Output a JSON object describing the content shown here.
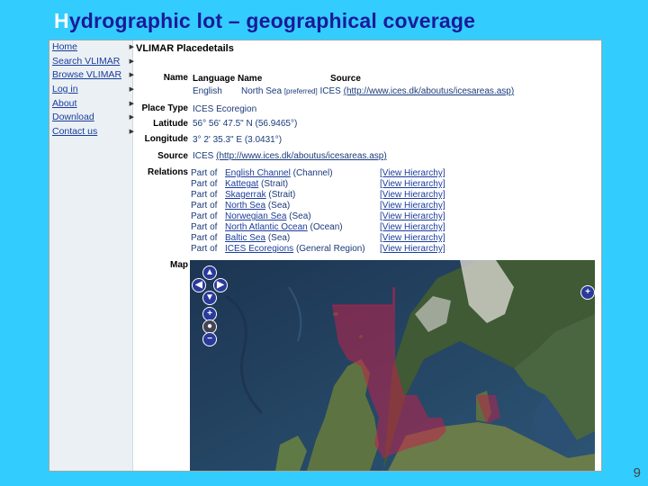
{
  "slide": {
    "title_first": "H",
    "title_rest": "ydrographic lot – geographical coverage",
    "page_number": "9"
  },
  "nav": {
    "items": [
      {
        "label": "Home"
      },
      {
        "label": "Search VLIMAR"
      },
      {
        "label": "Browse VLIMAR"
      },
      {
        "label": "Log in"
      },
      {
        "label": "About"
      },
      {
        "label": "Download"
      },
      {
        "label": "Contact us"
      }
    ]
  },
  "place": {
    "title": "VLIMAR Placedetails",
    "name_label": "Name",
    "language_header": "Language",
    "name_header": "Name",
    "source_header": "Source",
    "language": "English",
    "name_value": "North Sea",
    "preferred": "[preferred]",
    "name_source": "ICES",
    "name_source_link": "(http://www.ices.dk/aboutus/icesareas.asp)",
    "placetype_label": "Place Type",
    "placetype_value": "ICES Ecoregion",
    "latitude_label": "Latitude",
    "latitude_value": "56° 56' 47.5\" N (56.9465°)",
    "longitude_label": "Longitude",
    "longitude_value": "3° 2' 35.3\" E (3.0431°)",
    "source_label": "Source",
    "source_value": "ICES",
    "source_link": "(http://www.ices.dk/aboutus/icesareas.asp)",
    "relations_label": "Relations",
    "relations": [
      {
        "part": "Part of",
        "place": "English Channel",
        "type": "(Channel)",
        "hier": "[View Hierarchy]"
      },
      {
        "part": "Part of",
        "place": "Kattegat",
        "type": "(Strait)",
        "hier": "[View Hierarchy]"
      },
      {
        "part": "Part of",
        "place": "Skagerrak",
        "type": "(Strait)",
        "hier": "[View Hierarchy]"
      },
      {
        "part": "Part of",
        "place": "North Sea",
        "type": "(Sea)",
        "hier": "[View Hierarchy]"
      },
      {
        "part": "Part of",
        "place": "Norwegian Sea",
        "type": "(Sea)",
        "hier": "[View Hierarchy]"
      },
      {
        "part": "Part of",
        "place": "North Atlantic Ocean",
        "type": "(Ocean)",
        "hier": "[View Hierarchy]"
      },
      {
        "part": "Part of",
        "place": "Baltic Sea",
        "type": "(Sea)",
        "hier": "[View Hierarchy]"
      },
      {
        "part": "Part of",
        "place": "ICES Ecoregions",
        "type": "(General Region)",
        "hier": "[View Hierarchy]"
      }
    ],
    "map_label": "Map"
  },
  "colors": {
    "background": "#33ccff",
    "title": "#1a1a99",
    "link": "#1b3d9c",
    "overlay": "#c0204a"
  },
  "map_controls": {
    "pan_up": "▲",
    "pan_left": "◀",
    "pan_right": "▶",
    "pan_down": "▼",
    "zoom_in": "+",
    "zoom_out": "−",
    "layer_switch": "+"
  }
}
